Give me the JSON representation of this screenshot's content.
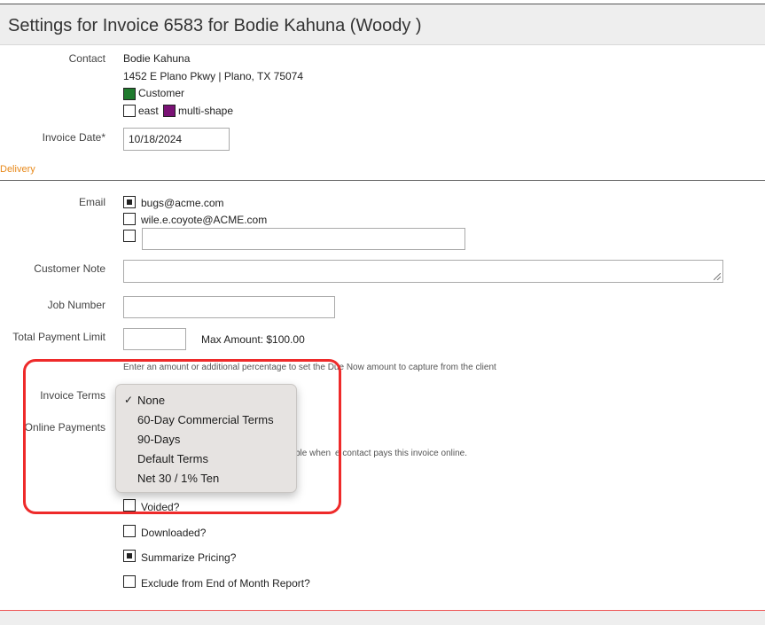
{
  "header": {
    "title": "Settings for Invoice 6583 for Bodie Kahuna (Woody )"
  },
  "contact": {
    "label": "Contact",
    "name": "Bodie Kahuna",
    "address": "1452 E Plano Pkwy | Plano, TX 75074",
    "tags": [
      {
        "text": "Customer",
        "color": "#1f7a2e"
      },
      {
        "text": "east",
        "color": "#ffffff"
      },
      {
        "text": "multi-shape",
        "color": "#7a1275"
      }
    ]
  },
  "invoice_date": {
    "label": "Invoice Date*",
    "value": "10/18/2024"
  },
  "delivery": {
    "section_label": "Delivery"
  },
  "email": {
    "label": "Email",
    "options": [
      {
        "address": "bugs@acme.com",
        "checked": true
      },
      {
        "address": "wile.e.coyote@ACME.com",
        "checked": false
      }
    ],
    "other_value": ""
  },
  "customer_note": {
    "label": "Customer Note",
    "value": ""
  },
  "job_number": {
    "label": "Job Number",
    "value": ""
  },
  "payment_limit": {
    "label": "Total Payment Limit",
    "value": "",
    "max_text": "Max Amount: $100.00",
    "hint": "Enter an amount or additional percentage to set the Due Now amount to capture from the client"
  },
  "invoice_terms": {
    "label": "Invoice Terms",
    "options": [
      {
        "text": "None",
        "selected": true
      },
      {
        "text": "60-Day Commercial Terms",
        "selected": false
      },
      {
        "text": "90-Days",
        "selected": false
      },
      {
        "text": "Default Terms",
        "selected": false
      },
      {
        "text": "Net 30 / 1% Ten",
        "selected": false
      }
    ]
  },
  "online_payments": {
    "label": "Online Payments",
    "hint_fragment_1": "ble when",
    "hint_fragment_2": "e contact pays this invoice online."
  },
  "flags": [
    {
      "text": "Voided?",
      "checked": false
    },
    {
      "text": "Downloaded?",
      "checked": false
    },
    {
      "text": "Summarize Pricing?",
      "checked": true
    },
    {
      "text": "Exclude from End of Month Report?",
      "checked": false
    }
  ],
  "colors": {
    "section_accent": "#e8891a",
    "annotation": "#ee2a2a",
    "header_bg": "#eeeeee"
  }
}
